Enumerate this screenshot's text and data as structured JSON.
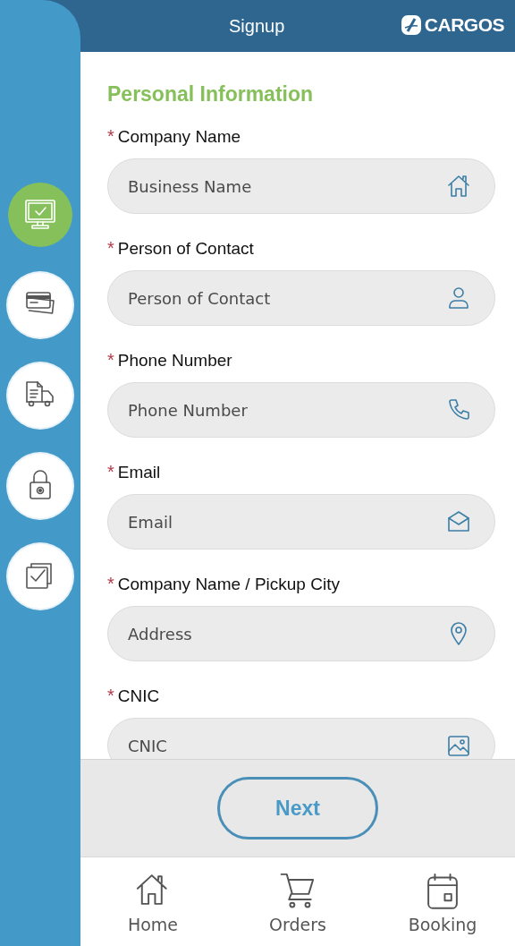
{
  "header": {
    "title": "Signup",
    "logo": "CARGOS"
  },
  "steps": [
    {
      "kind": "monitor",
      "selected": true
    },
    {
      "kind": "card",
      "selected": false
    },
    {
      "kind": "truck",
      "selected": false
    },
    {
      "kind": "lock",
      "selected": false
    },
    {
      "kind": "checklist",
      "selected": false
    }
  ],
  "section_title": "Personal Information",
  "fields": [
    {
      "required_mark": "*",
      "label": "Company Name",
      "placeholder": "Business Name",
      "kind": "home"
    },
    {
      "required_mark": "*",
      "label": "Person of Contact",
      "placeholder": "Person of Contact",
      "kind": "person"
    },
    {
      "required_mark": "*",
      "label": "Phone Number",
      "placeholder": "Phone Number",
      "kind": "phone"
    },
    {
      "required_mark": "*",
      "label": "Email",
      "placeholder": "Email",
      "kind": "email"
    },
    {
      "required_mark": "*",
      "label": "Company Name / Pickup City",
      "placeholder": "Address",
      "kind": "pin"
    },
    {
      "required_mark": "*",
      "label": "CNIC",
      "placeholder": "CNIC",
      "kind": "image"
    }
  ],
  "next_button": "Next",
  "nav": [
    {
      "label": "Home",
      "kind": "home"
    },
    {
      "label": "Orders",
      "kind": "cart"
    },
    {
      "label": "Booking",
      "kind": "calendar"
    }
  ]
}
